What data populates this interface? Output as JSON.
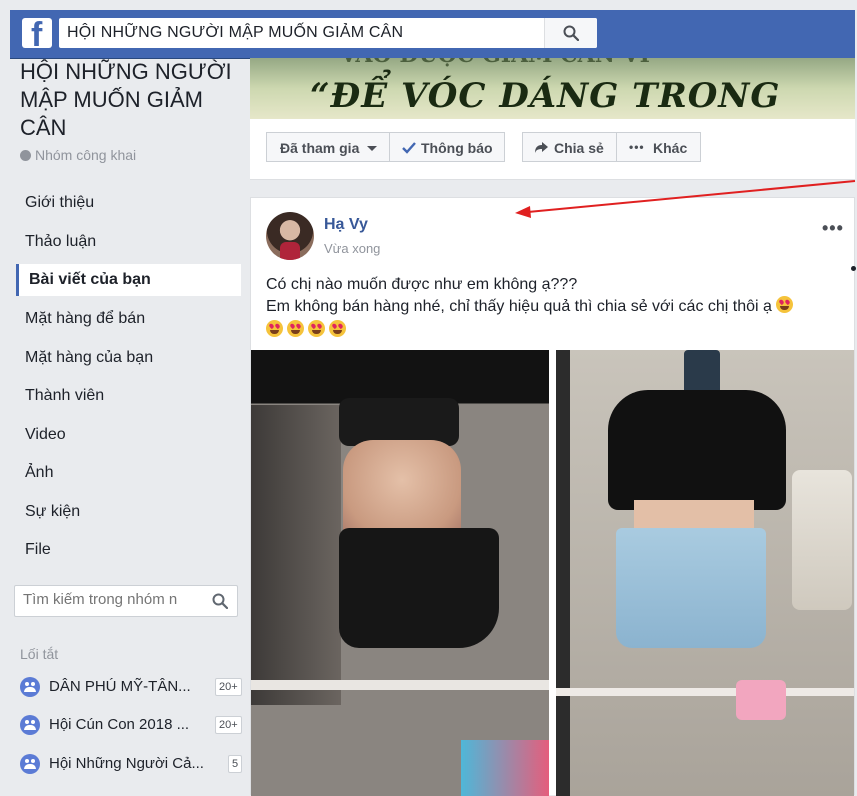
{
  "topbar": {
    "logo": "f",
    "search_value": "HỘI NHỮNG NGƯỜI MẬP MUỐN GIẢM CÂN",
    "search_icon": "magnifier-icon",
    "brand_color": "#4267b2"
  },
  "group": {
    "title": "HỘI NHỮNG NGƯỜI MẬP MUỐN GIẢM CÂN",
    "type": "Nhóm công khai"
  },
  "nav": [
    {
      "label": "Giới thiệu",
      "active": false
    },
    {
      "label": "Thảo luận",
      "active": false
    },
    {
      "label": "Bài viết của bạn",
      "active": true
    },
    {
      "label": "Mặt hàng để bán",
      "active": false
    },
    {
      "label": "Mặt hàng của bạn",
      "active": false
    },
    {
      "label": "Thành viên",
      "active": false
    },
    {
      "label": "Video",
      "active": false
    },
    {
      "label": "Ảnh",
      "active": false
    },
    {
      "label": "Sự kiện",
      "active": false
    },
    {
      "label": "File",
      "active": false
    }
  ],
  "side_search": {
    "placeholder": "Tìm kiếm trong nhóm n"
  },
  "shortcuts": {
    "heading": "Lối tắt",
    "items": [
      {
        "label": "DÂN PHÚ MỸ-TÂN...",
        "badge": "20+"
      },
      {
        "label": "Hội Cún Con 2018 ...",
        "badge": "20+"
      },
      {
        "label": "Hội Những Người Cả...",
        "badge": "5"
      }
    ]
  },
  "cover": {
    "top_text": "VÀO ĐƯỢC GIẢM CÂN VI",
    "main_text": "“ĐỂ VÓC DÁNG TRONG"
  },
  "actions": {
    "joined": "Đã tham gia",
    "notify": "Thông báo",
    "share": "Chia sẻ",
    "more": "Khác"
  },
  "post": {
    "author": "Hạ Vy",
    "time": "Vừa xong",
    "more_icon": "•••",
    "line1": "Có chị nào muốn được như em không ạ???",
    "line2": "Em không bán hàng nhé, chỉ thấy hiệu quả thì chia sẻ với các chị thôi ạ"
  }
}
